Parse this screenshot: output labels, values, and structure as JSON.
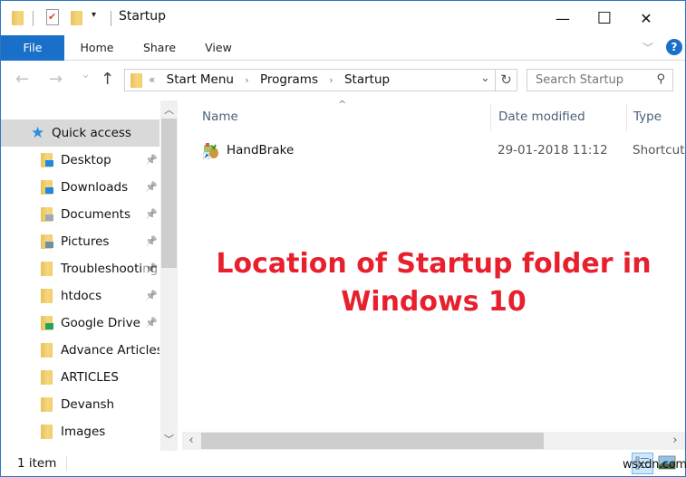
{
  "window": {
    "title": "Startup",
    "controls": {
      "minimize": "—",
      "maximize": "☐",
      "close": "✕"
    }
  },
  "quick_access_toolbar": {
    "icons": [
      "folder-icon",
      "properties-icon",
      "new-folder-icon",
      "customize-dropdown-icon"
    ],
    "dropdown_glyph": "▾"
  },
  "ribbon": {
    "tabs": [
      {
        "label": "File",
        "active": true
      },
      {
        "label": "Home"
      },
      {
        "label": "Share"
      },
      {
        "label": "View"
      }
    ],
    "expand_glyph": "﹀",
    "help_glyph": "?"
  },
  "navigation": {
    "back_glyph": "←",
    "forward_glyph": "→",
    "recent_glyph": "⌄",
    "up_glyph": "↑",
    "overflow_glyph": "«",
    "breadcrumb": [
      "Start Menu",
      "Programs",
      "Startup"
    ],
    "separator_glyph": "›",
    "dropdown_glyph": "⌄",
    "refresh_glyph": "↻",
    "search": {
      "placeholder": "Search Startup",
      "value": "",
      "icon_glyph": "⚲"
    }
  },
  "sidebar": {
    "quick_access_label": "Quick access",
    "items": [
      {
        "label": "Desktop",
        "icon": "desktop-folder-icon",
        "pinned": true
      },
      {
        "label": "Downloads",
        "icon": "downloads-folder-icon",
        "pinned": true
      },
      {
        "label": "Documents",
        "icon": "documents-folder-icon",
        "pinned": true
      },
      {
        "label": "Pictures",
        "icon": "pictures-folder-icon",
        "pinned": true
      },
      {
        "label": "Troubleshooting",
        "icon": "folder-icon",
        "pinned": true
      },
      {
        "label": "htdocs",
        "icon": "folder-icon",
        "pinned": true
      },
      {
        "label": "Google Drive",
        "icon": "google-drive-folder-icon",
        "pinned": true
      },
      {
        "label": "Advance Articles",
        "icon": "folder-icon",
        "pinned": false
      },
      {
        "label": "ARTICLES",
        "icon": "folder-icon",
        "pinned": false
      },
      {
        "label": "Devansh",
        "icon": "folder-icon",
        "pinned": false
      },
      {
        "label": "Images",
        "icon": "folder-icon",
        "pinned": false
      }
    ],
    "pin_glyph": "📌"
  },
  "file_list": {
    "columns": [
      "Name",
      "Date modified",
      "Type"
    ],
    "sort_glyph": "^",
    "rows": [
      {
        "name": "HandBrake",
        "date_modified": "29-01-2018 11:12",
        "type": "Shortcut"
      }
    ]
  },
  "annotation": {
    "line1": "Location of Startup folder in",
    "line2": "Windows 10",
    "color": "#e8202e"
  },
  "status_bar": {
    "item_count": "1 item",
    "watermark": "wsxdn.com"
  },
  "colors": {
    "accent": "#1a6fc8",
    "selection": "#d9d9d9",
    "header_text": "#4c607a"
  }
}
